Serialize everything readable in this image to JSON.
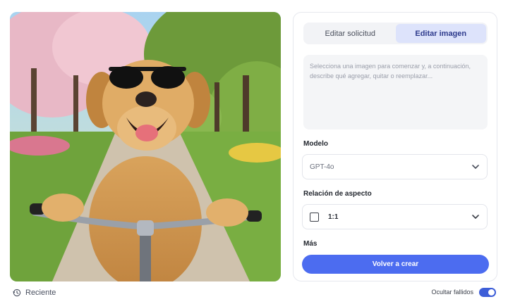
{
  "preview": {
    "alt": "golden retriever with sunglasses riding a bicycle"
  },
  "tabs": [
    {
      "label": "Editar solicitud",
      "active": false
    },
    {
      "label": "Editar imagen",
      "active": true
    }
  ],
  "prompt": {
    "value": "",
    "placeholder": "Selecciona una imagen para comenzar y, a continuación, describe qué agregar, quitar o reemplazar..."
  },
  "model": {
    "label": "Modelo",
    "selected": "GPT-4o"
  },
  "aspect": {
    "label": "Relación de aspecto",
    "selected": "1:1"
  },
  "more": {
    "label": "Más"
  },
  "create_button": {
    "label": "Volver a crear"
  },
  "recent": {
    "label": "Reciente",
    "icon": "history-icon"
  },
  "hide_failed": {
    "label": "Ocultar fallidos",
    "enabled": true
  },
  "colors": {
    "accent": "#4c6cf0",
    "tab_active_bg": "#dde3fb",
    "toggle": "#3d5ed8"
  }
}
